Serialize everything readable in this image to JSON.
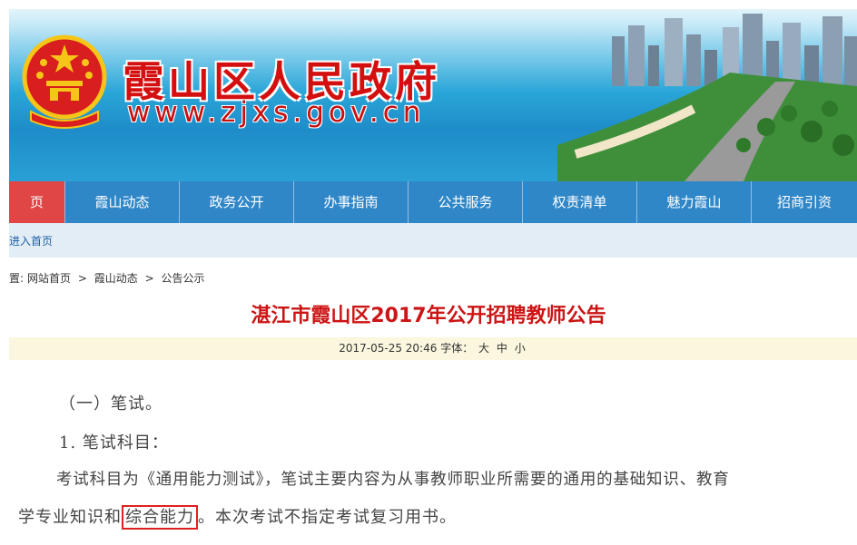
{
  "banner": {
    "title": "霞山区人民政府",
    "url": "www.zjxs.gov.cn"
  },
  "nav": {
    "items": [
      {
        "label": "页",
        "active": true
      },
      {
        "label": "霞山动态",
        "active": false
      },
      {
        "label": "政务公开",
        "active": false
      },
      {
        "label": "办事指南",
        "active": false
      },
      {
        "label": "公共服务",
        "active": false
      },
      {
        "label": "权责清单",
        "active": false
      },
      {
        "label": "魅力霞山",
        "active": false
      },
      {
        "label": "招商引资",
        "active": false
      }
    ],
    "sub_link": "进入首页"
  },
  "breadcrumb": {
    "prefix": "置:",
    "items": [
      "网站首页",
      "霞山动态",
      "公告公示"
    ],
    "separator": ">"
  },
  "article": {
    "title": "湛江市霞山区2017年公开招聘教师公告",
    "datetime": "2017-05-25 20:46",
    "font_label": "字体：",
    "sizes": [
      "大",
      "中",
      "小"
    ],
    "paragraphs": {
      "p1": "（一）笔试。",
      "p2": "1. 笔试科目：",
      "p3": "考试科目为《通用能力测试》，笔试主要内容为从事教师职业所需要的通用的基础知识、教育",
      "p4_before": "学专业知识和",
      "p4_highlight": "综合能力",
      "p4_after": "。本次考试不指定考试复习用书。"
    }
  },
  "colors": {
    "nav_bg": "#2f87c8",
    "nav_active": "#e04646",
    "title_red": "#cc1515",
    "highlight_box": "#e02020"
  }
}
